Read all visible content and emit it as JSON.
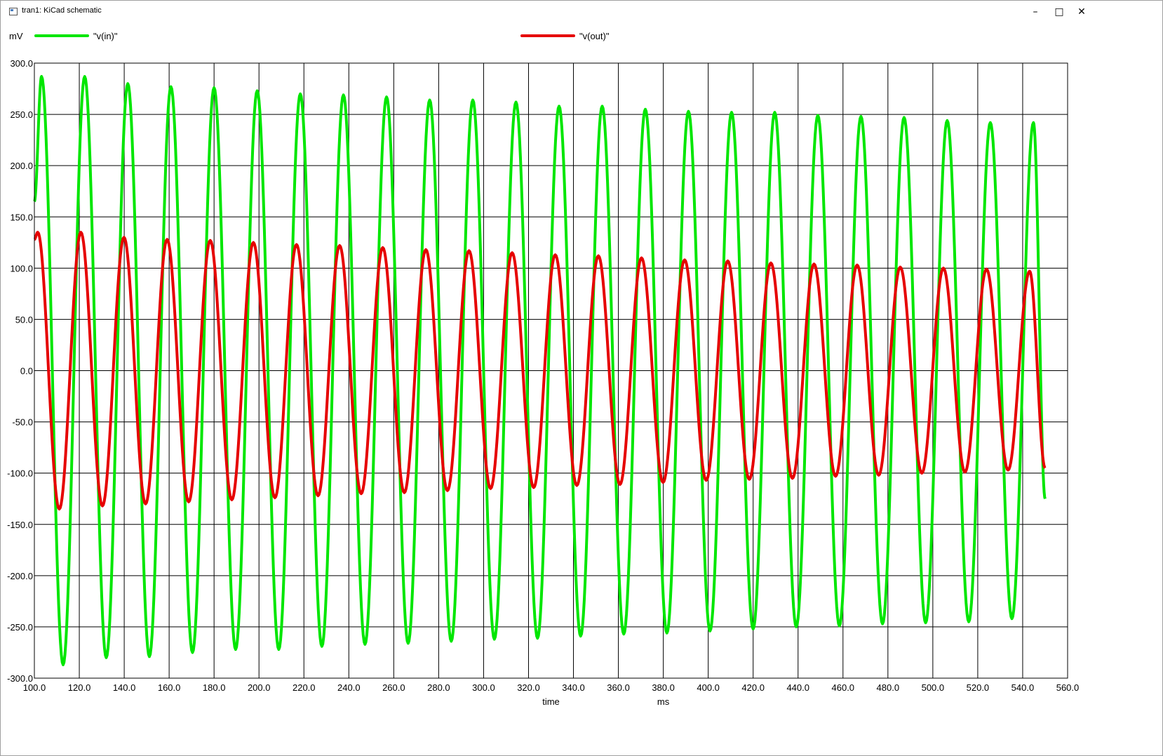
{
  "window": {
    "title": "tran1: KiCad schematic",
    "buttons": {
      "minimize": "–",
      "maximize": "□",
      "close": "✕"
    }
  },
  "legend": {
    "unit": "mV",
    "items": [
      {
        "label": "\"v(in)\"",
        "color": "#00e600"
      },
      {
        "label": "\"v(out)\"",
        "color": "#e60000"
      }
    ]
  },
  "chart_data": {
    "type": "line",
    "title": "",
    "xlabel": "time",
    "xunit": "ms",
    "ylabel": "mV",
    "xlim": [
      100,
      560
    ],
    "ylim": [
      -300,
      300
    ],
    "grid": true,
    "legend_placement": "top",
    "x_ticks": [
      "100.0",
      "120.0",
      "140.0",
      "160.0",
      "180.0",
      "200.0",
      "220.0",
      "240.0",
      "260.0",
      "280.0",
      "300.0",
      "320.0",
      "340.0",
      "360.0",
      "380.0",
      "400.0",
      "420.0",
      "440.0",
      "460.0",
      "480.0",
      "500.0",
      "520.0",
      "540.0",
      "560.0"
    ],
    "y_ticks": [
      "300.0",
      "250.0",
      "200.0",
      "150.0",
      "100.0",
      "50.0",
      "0.0",
      "-50.0",
      "-100.0",
      "-150.0",
      "-200.0",
      "-250.0",
      "-300.0"
    ],
    "series": [
      {
        "name": "\"v(in)\"",
        "color": "#00e600",
        "x": [
          100.0,
          103.2,
          112.8,
          122.4,
          132.0,
          141.6,
          151.2,
          160.8,
          170.4,
          180.0,
          189.6,
          199.2,
          208.8,
          218.4,
          228.0,
          237.6,
          247.2,
          256.8,
          266.4,
          276.0,
          285.6,
          295.2,
          304.8,
          314.4,
          324.0,
          333.6,
          343.2,
          352.8,
          362.4,
          372.0,
          381.6,
          391.2,
          400.8,
          410.4,
          420.0,
          429.6,
          439.2,
          448.8,
          458.4,
          468.0,
          477.6,
          487.2,
          496.8,
          506.4,
          516.0,
          525.6,
          535.2,
          544.8,
          550.0
        ],
        "y": [
          165,
          287,
          -287,
          287,
          -280,
          280,
          -279,
          277,
          -275,
          276,
          -272,
          273,
          -272,
          270,
          -269,
          269,
          -267,
          267,
          -266,
          264,
          -264,
          264,
          -262,
          262,
          -261,
          258,
          -259,
          258,
          -257,
          255,
          -256,
          253,
          -254,
          252,
          -252,
          252,
          -250,
          249,
          -249,
          248,
          -247,
          247,
          -246,
          244,
          -245,
          242,
          -242,
          242,
          -125
        ]
      },
      {
        "name": "\"v(out)\"",
        "color": "#e60000",
        "x": [
          100.0,
          101.5,
          111.1,
          120.7,
          130.3,
          139.9,
          149.5,
          159.1,
          168.7,
          178.3,
          187.9,
          197.5,
          207.1,
          216.7,
          226.3,
          235.9,
          245.5,
          255.1,
          264.7,
          274.3,
          283.9,
          293.5,
          303.1,
          312.7,
          322.3,
          331.9,
          341.5,
          351.1,
          360.7,
          370.3,
          379.9,
          389.5,
          399.1,
          408.7,
          418.3,
          427.9,
          437.5,
          447.1,
          456.7,
          466.3,
          475.9,
          485.5,
          495.1,
          504.7,
          514.3,
          523.9,
          533.5,
          543.1,
          550.0
        ],
        "y": [
          128,
          135,
          -135,
          135,
          -132,
          130,
          -130,
          128,
          -128,
          127,
          -126,
          125,
          -124,
          123,
          -122,
          122,
          -120,
          120,
          -119,
          118,
          -117,
          117,
          -115,
          115,
          -114,
          113,
          -112,
          112,
          -111,
          110,
          -109,
          108,
          -107,
          107,
          -106,
          105,
          -105,
          104,
          -103,
          103,
          -102,
          101,
          -100,
          100,
          -99,
          99,
          -97,
          97,
          -95
        ]
      }
    ]
  }
}
